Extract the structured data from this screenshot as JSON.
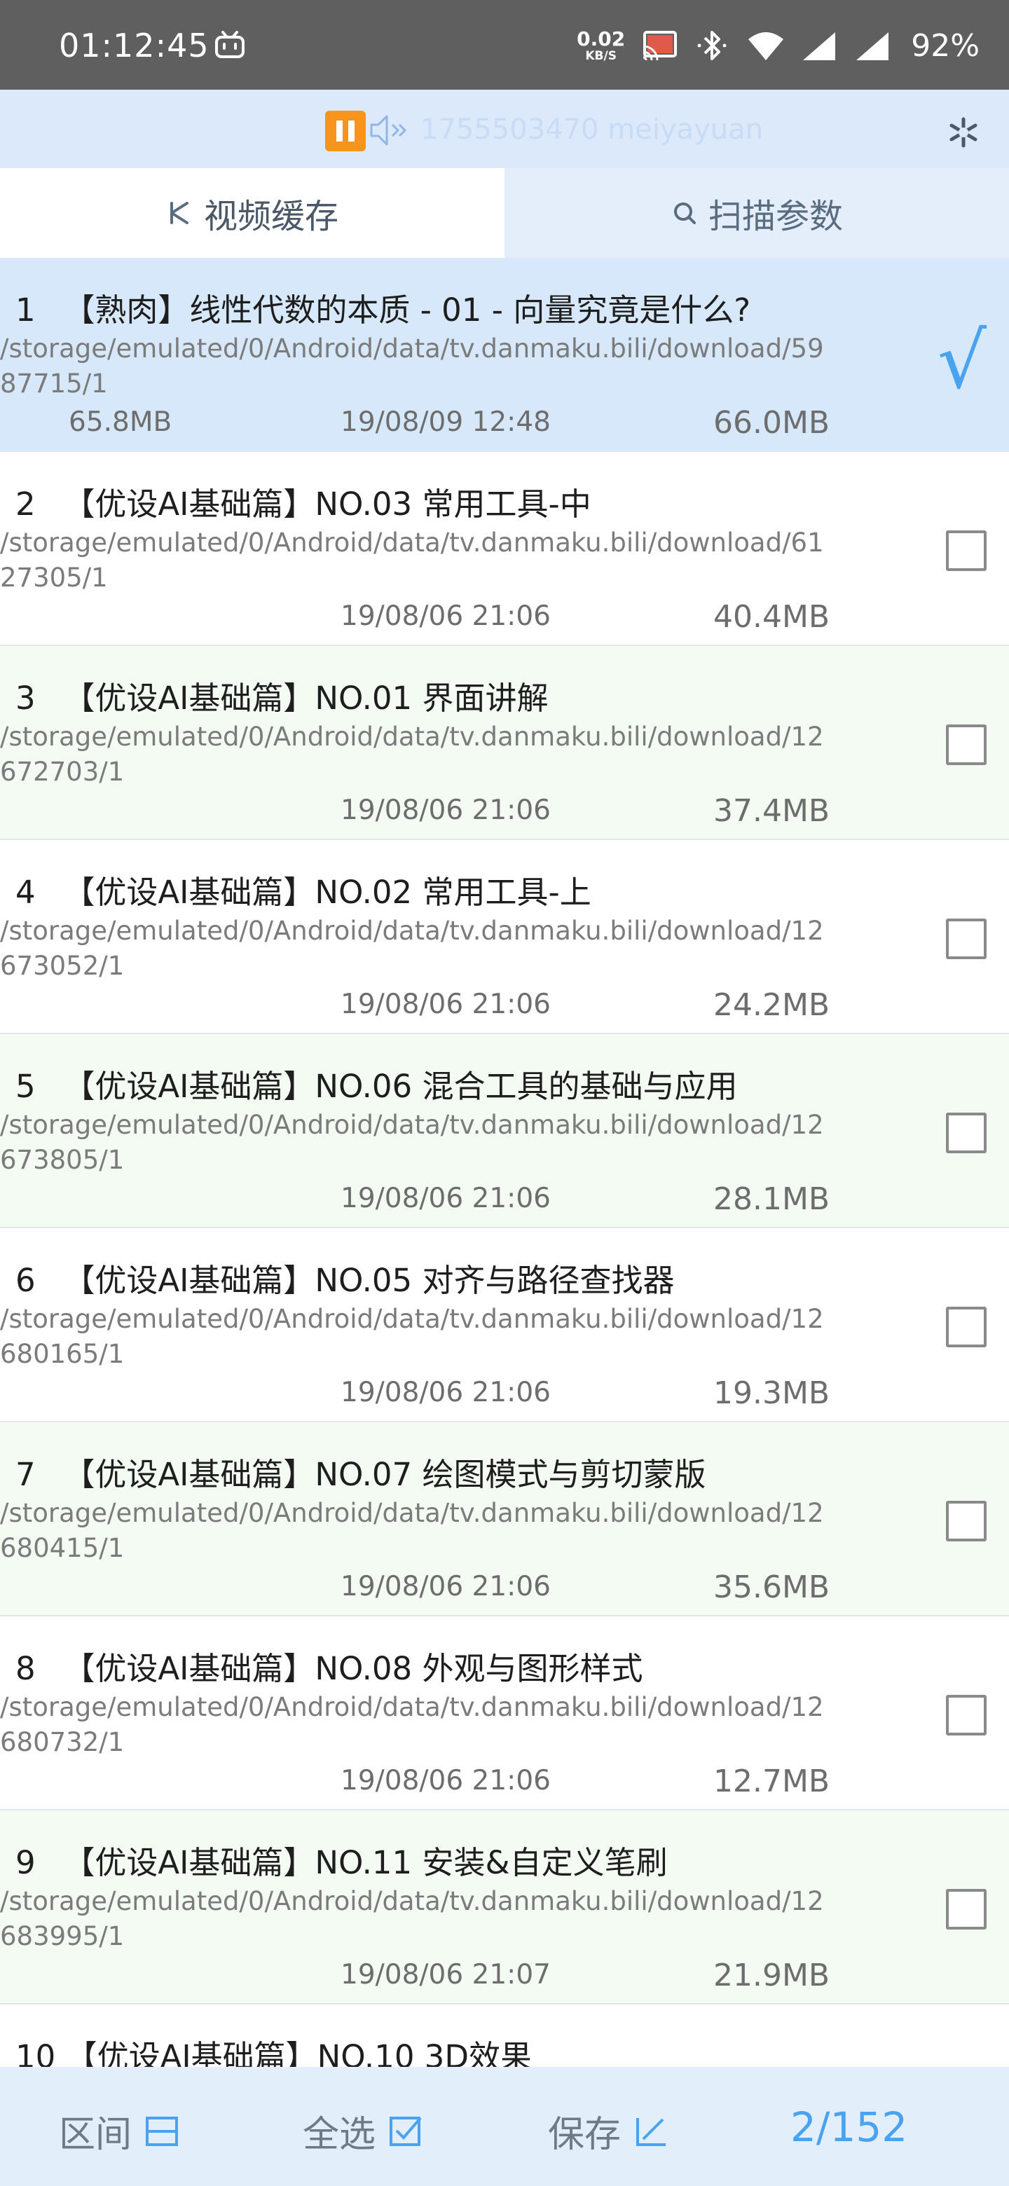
{
  "status_bar": {
    "time": "01:12:45",
    "net_speed_value": "0.02",
    "net_speed_unit": "KB/S",
    "battery": "92%"
  },
  "toolbar": {
    "ghost_text": "1755503470 meiyayuan"
  },
  "tabs": [
    {
      "label": "视频缓存",
      "active": true
    },
    {
      "label": "扫描参数",
      "active": false
    }
  ],
  "items": [
    {
      "index": "1",
      "title": "【熟肉】线性代数的本质 - 01 - 向量究竟是什么?",
      "path": "/storage/emulated/0/Android/data/tv.danmaku.bili/download/5987715/1",
      "local_size": "65.8MB",
      "date": "19/08/09 12:48",
      "size": "66.0MB",
      "checked": true
    },
    {
      "index": "2",
      "title": "【优设AI基础篇】NO.03 常用工具-中",
      "path": "/storage/emulated/0/Android/data/tv.danmaku.bili/download/6127305/1",
      "local_size": "",
      "date": "19/08/06 21:06",
      "size": "40.4MB",
      "checked": false
    },
    {
      "index": "3",
      "title": "【优设AI基础篇】NO.01 界面讲解",
      "path": "/storage/emulated/0/Android/data/tv.danmaku.bili/download/12672703/1",
      "local_size": "",
      "date": "19/08/06 21:06",
      "size": "37.4MB",
      "checked": false
    },
    {
      "index": "4",
      "title": "【优设AI基础篇】NO.02 常用工具-上",
      "path": "/storage/emulated/0/Android/data/tv.danmaku.bili/download/12673052/1",
      "local_size": "",
      "date": "19/08/06 21:06",
      "size": "24.2MB",
      "checked": false
    },
    {
      "index": "5",
      "title": "【优设AI基础篇】NO.06 混合工具的基础与应用",
      "path": "/storage/emulated/0/Android/data/tv.danmaku.bili/download/12673805/1",
      "local_size": "",
      "date": "19/08/06 21:06",
      "size": "28.1MB",
      "checked": false
    },
    {
      "index": "6",
      "title": "【优设AI基础篇】NO.05 对齐与路径查找器",
      "path": "/storage/emulated/0/Android/data/tv.danmaku.bili/download/12680165/1",
      "local_size": "",
      "date": "19/08/06 21:06",
      "size": "19.3MB",
      "checked": false
    },
    {
      "index": "7",
      "title": "【优设AI基础篇】NO.07 绘图模式与剪切蒙版",
      "path": "/storage/emulated/0/Android/data/tv.danmaku.bili/download/12680415/1",
      "local_size": "",
      "date": "19/08/06 21:06",
      "size": "35.6MB",
      "checked": false
    },
    {
      "index": "8",
      "title": "【优设AI基础篇】NO.08 外观与图形样式",
      "path": "/storage/emulated/0/Android/data/tv.danmaku.bili/download/12680732/1",
      "local_size": "",
      "date": "19/08/06 21:06",
      "size": "12.7MB",
      "checked": false
    },
    {
      "index": "9",
      "title": "【优设AI基础篇】NO.11 安装&自定义笔刷",
      "path": "/storage/emulated/0/Android/data/tv.danmaku.bili/download/12683995/1",
      "local_size": "",
      "date": "19/08/06 21:07",
      "size": "21.9MB",
      "checked": false
    },
    {
      "index": "10",
      "title": "【优设AI基础篇】NO.10 3D效果",
      "path": "",
      "local_size": "",
      "date": "",
      "size": "",
      "checked": false
    }
  ],
  "bottom_bar": {
    "range_label": "区间",
    "select_all_label": "全选",
    "save_label": "保存",
    "page_count": "2/152"
  },
  "colors": {
    "status_bar": "#5f5f5f",
    "toolbar": "#dbe9fa",
    "selected_row": "#d7e8fb",
    "alt_row": "#f3fbf3",
    "accent": "#4aa3f0",
    "pause": "#f7941d"
  }
}
